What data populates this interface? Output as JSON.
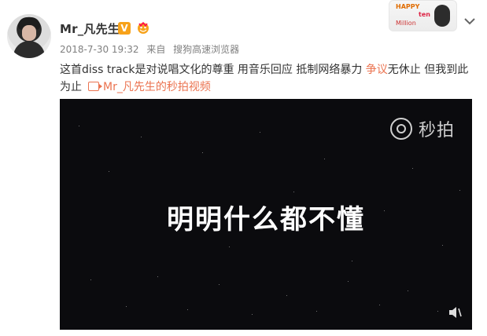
{
  "post": {
    "username": "Mr_凡先生",
    "badge": "V",
    "meta": {
      "date_time": "2018-7-30 19:32",
      "source_prefix": "来自",
      "source": "搜狗高速浏览器"
    },
    "text_before": "这首diss track是对说唱文化的尊重  用音乐回应  抵制网络暴力 ",
    "highlight": "争议",
    "text_after": "无休止 但我到此为止",
    "video_link": "Mr_凡先生的秒拍视频"
  },
  "video": {
    "title": "明明什么都不懂",
    "watermark": "秒拍",
    "mute_icon": "speaker-muted-icon"
  },
  "header_sticker": {
    "line1": "HAPPY",
    "line2": "ten",
    "line3": "Million"
  },
  "colors": {
    "accent": "#eb7350",
    "badge": "#f7a21a",
    "text": "#333333",
    "meta": "#808080",
    "video_bg": "#0b0b0e"
  }
}
